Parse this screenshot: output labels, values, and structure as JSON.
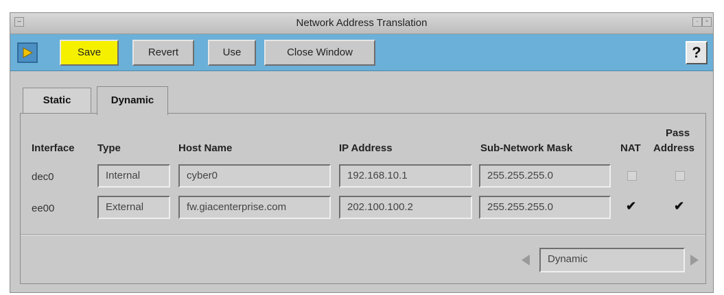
{
  "window": {
    "title": "Network Address Translation"
  },
  "toolbar": {
    "save_label": "Save",
    "revert_label": "Revert",
    "use_label": "Use",
    "close_label": "Close Window",
    "help_label": "?"
  },
  "tabs": [
    {
      "label": "Static",
      "active": false
    },
    {
      "label": "Dynamic",
      "active": true
    }
  ],
  "table": {
    "headers": {
      "interface": "Interface",
      "type": "Type",
      "host_name": "Host Name",
      "ip_address": "IP Address",
      "subnet_mask": "Sub-Network Mask",
      "nat": "NAT",
      "pass_address_1": "Pass",
      "pass_address_2": "Address"
    },
    "rows": [
      {
        "interface": "dec0",
        "type": "Internal",
        "host_name": "cyber0",
        "ip_address": "192.168.10.1",
        "subnet_mask": "255.255.255.0",
        "nat": false,
        "pass_address": false
      },
      {
        "interface": "ee00",
        "type": "External",
        "host_name": "fw.giacenterprise.com",
        "ip_address": "202.100.100.2",
        "subnet_mask": "255.255.255.0",
        "nat": true,
        "pass_address": true
      }
    ]
  },
  "selector": {
    "value": "Dynamic"
  },
  "colors": {
    "toolbar": "#6bb0d8",
    "save_button": "#f5f000",
    "window_bg": "#c9c9c9"
  }
}
